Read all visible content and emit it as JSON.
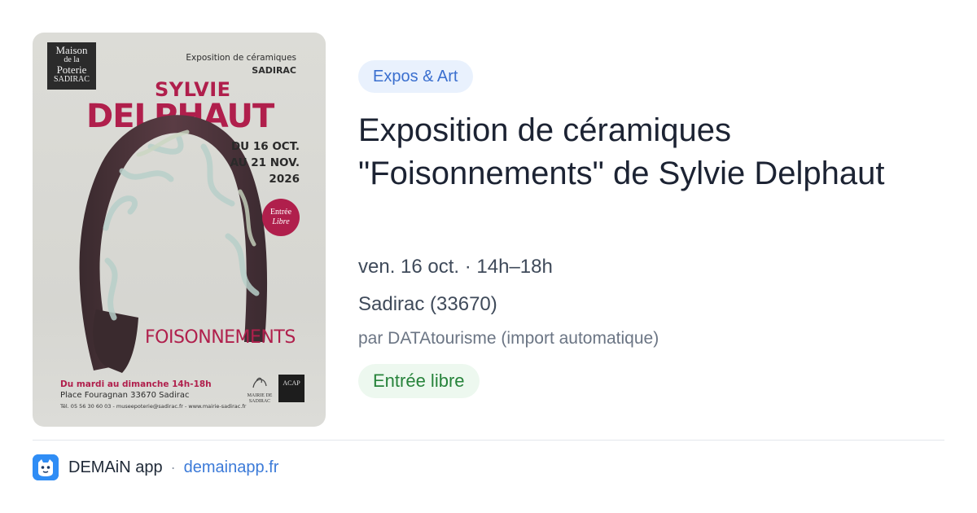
{
  "poster": {
    "logo_line1": "Maison",
    "logo_line2": "de la",
    "logo_line3": "Poterie",
    "logo_line4": "SADIRAC",
    "top_line1": "Exposition de céramiques",
    "top_line2": "SADIRAC",
    "artist_first": "SYLVIE",
    "artist_last": "DELPHAUT",
    "dates_line1": "DU 16 OCT.",
    "dates_line2": "AU 21 NOV.",
    "dates_line3": "2026",
    "entree_line1": "Entrée",
    "entree_line2": "Libre",
    "exhibit_name": "FOISONNEMENTS",
    "hours": "Du mardi au dimanche 14h-18h",
    "address": "Place Fouragnan 33670 Sadirac",
    "contact": "Tél. 05 56 30 60 03 - museepoterie@sadirac.fr - www.mairie-sadirac.fr",
    "mairie": "MAIRIE DE SADIRAC",
    "acap": "ACAP"
  },
  "event": {
    "category": "Expos & Art",
    "title": "Exposition de céramiques \"Foisonnements\" de Sylvie Delphaut",
    "datetime": "ven. 16 oct. · 14h–18h",
    "location": "Sadirac (33670)",
    "source": "par DATAtourisme (import automatique)",
    "price": "Entrée libre"
  },
  "footer": {
    "app_name": "DEMAiN app",
    "separator": "·",
    "domain": "demainapp.fr"
  },
  "colors": {
    "category_bg": "#e9f1fd",
    "category_text": "#3a6fcf",
    "price_bg": "#edf8ef",
    "price_text": "#27833b",
    "link": "#3b7ad8",
    "poster_accent": "#b01f4c"
  },
  "icons": {
    "app": "demain-app-icon"
  }
}
